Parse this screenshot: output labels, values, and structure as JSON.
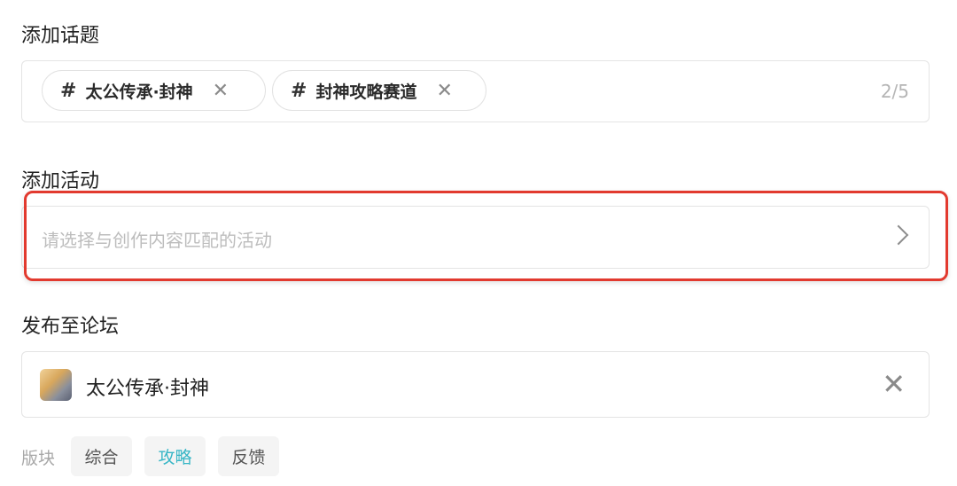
{
  "topics": {
    "title": "添加话题",
    "chips": [
      {
        "hash": "#",
        "label": "太公传承·封神",
        "remove": "✕"
      },
      {
        "hash": "#",
        "label": "封神攻略赛道",
        "remove": "✕"
      }
    ],
    "counter": "2/5"
  },
  "activity": {
    "title": "添加活动",
    "placeholder": "请选择与创作内容匹配的活动"
  },
  "forum": {
    "title": "发布至论坛",
    "name": "太公传承·封神",
    "close": "✕",
    "board_label": "版块",
    "boards": [
      {
        "label": "综合",
        "active": false
      },
      {
        "label": "攻略",
        "active": true
      },
      {
        "label": "反馈",
        "active": false
      }
    ]
  },
  "colors": {
    "highlight": "#e23a2f",
    "active_tab": "#38b6c6"
  }
}
